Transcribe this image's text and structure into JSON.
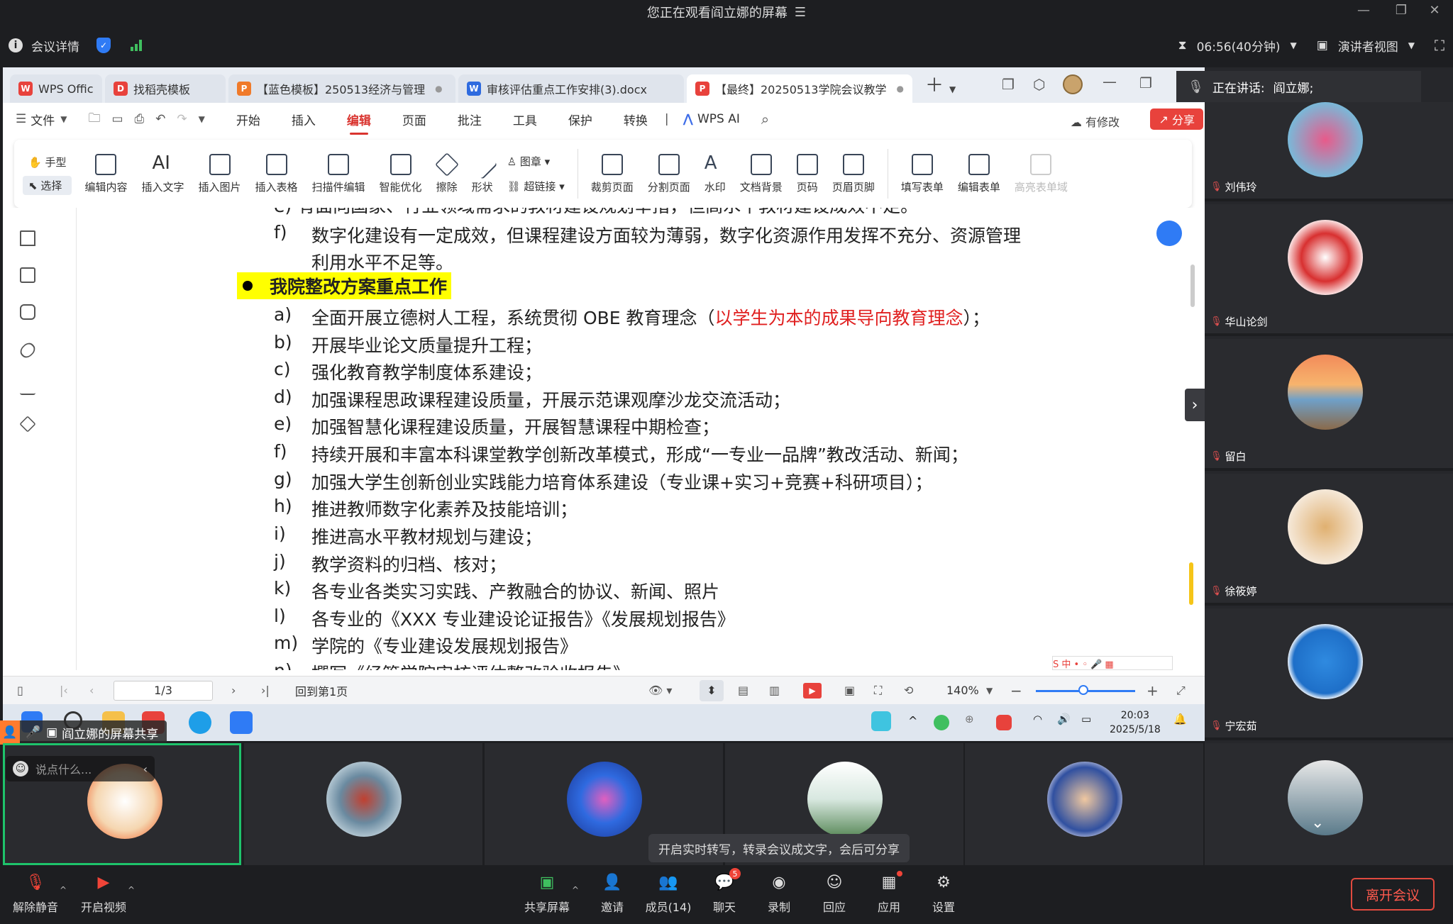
{
  "meeting": {
    "title": "您正在观看阎立娜的屏幕",
    "details": "会议详情",
    "timer": "06:56(40分钟)",
    "presenter_view": "演讲者视图",
    "speaking_label": "正在讲话:",
    "speaking_name": "阎立娜;"
  },
  "wps": {
    "tabs": [
      {
        "label": "WPS Offic",
        "icon": "W",
        "color": "#e8423c"
      },
      {
        "label": "找稻壳模板",
        "icon": "D",
        "color": "#e8423c"
      },
      {
        "label": "【蓝色模板】250513经济与管理",
        "icon": "P",
        "color": "#f07a2a"
      },
      {
        "label": "审核评估重点工作安排(3).docx",
        "icon": "W",
        "color": "#2f6bdf"
      },
      {
        "label": "【最终】20250513学院会议教学",
        "icon": "P",
        "color": "#e8423c"
      }
    ],
    "menu": [
      "文件",
      "开始",
      "插入",
      "编辑",
      "页面",
      "批注",
      "工具",
      "保护",
      "转换",
      "WPS AI"
    ],
    "modified": "有修改",
    "share": "分享",
    "ribbon": {
      "hand": "手型",
      "select": "选择",
      "tools": [
        "编辑内容",
        "插入文字",
        "插入图片",
        "插入表格",
        "扫描件编辑",
        "智能优化",
        "擦除",
        "形状",
        "图章",
        "超链接",
        "裁剪页面",
        "分割页面",
        "水印",
        "文档背景",
        "页码",
        "页眉页脚",
        "填写表单",
        "编辑表单",
        "高亮表单域"
      ]
    }
  },
  "document": {
    "top_cut_line": "e)    有面向国家、行业领域需求的教材建设规划举措，但高水平教材建设成效不足。",
    "item_f_label": "f)",
    "item_f_line1": "数字化建设有一定成效，但课程建设方面较为薄弱，数字化资源作用发挥不充分、资源管理",
    "item_f_line2": "利用水平不足等。",
    "heading": "我院整改方案重点工作",
    "items": [
      {
        "label": "a)",
        "text": "全面开展立德树人工程，系统贯彻 OBE 教育理念（",
        "red": "以学生为本的成果导向教育理念",
        "tail": "）；"
      },
      {
        "label": "b)",
        "text": "开展毕业论文质量提升工程；"
      },
      {
        "label": "c)",
        "text": "强化教育教学制度体系建设；"
      },
      {
        "label": "d)",
        "text": "加强课程思政课程建设质量，开展示范课观摩沙龙交流活动；"
      },
      {
        "label": "e)",
        "text": "加强智慧化课程建设质量，开展智慧课程中期检查；"
      },
      {
        "label": "f)",
        "text": "持续开展和丰富本科课堂教学创新改革模式，形成“一专业一品牌”教改活动、新闻；"
      },
      {
        "label": "g)",
        "text": "加强大学生创新创业实践能力培育体系建设（专业课+实习+竞赛+科研项目）；"
      },
      {
        "label": "h)",
        "text": "推进教师数字化素养及技能培训；"
      },
      {
        "label": "i)",
        "text": "推进高水平教材规划与建设；"
      },
      {
        "label": "j)",
        "text": "教学资料的归档、核对；"
      },
      {
        "label": "k)",
        "text": "各专业各类实习实践、产教融合的协议、新闻、照片"
      },
      {
        "label": "l)",
        "text": "各专业的《XXX 专业建设论证报告》《发展规划报告》"
      },
      {
        "label": "m)",
        "text": "学院的《专业建设发展规划报告》"
      },
      {
        "label": "n)",
        "text": "撰写《经管学院审核评估整改验收报告》"
      }
    ]
  },
  "status": {
    "page": "1/3",
    "back_first": "回到第1页",
    "zoom": "140%"
  },
  "taskbar": {
    "time": "20:03",
    "date": "2025/5/18"
  },
  "sharing_label": "阎立娜的屏幕共享",
  "comment_placeholder": "说点什么...",
  "participants": [
    {
      "name": "刘伟玲"
    },
    {
      "name": "华山论剑"
    },
    {
      "name": "留白"
    },
    {
      "name": "徐筱婷"
    },
    {
      "name": "宁宏茹"
    }
  ],
  "tooltip": "开启实时转写，转录会议成文字，会后可分享",
  "bottom": {
    "unmute": "解除静音",
    "video": "开启视频",
    "share": "共享屏幕",
    "invite": "邀请",
    "members": "成员(14)",
    "chat": "聊天",
    "chat_badge": "5",
    "record": "录制",
    "reply": "回应",
    "apps": "应用",
    "settings": "设置",
    "leave": "离开会议"
  }
}
